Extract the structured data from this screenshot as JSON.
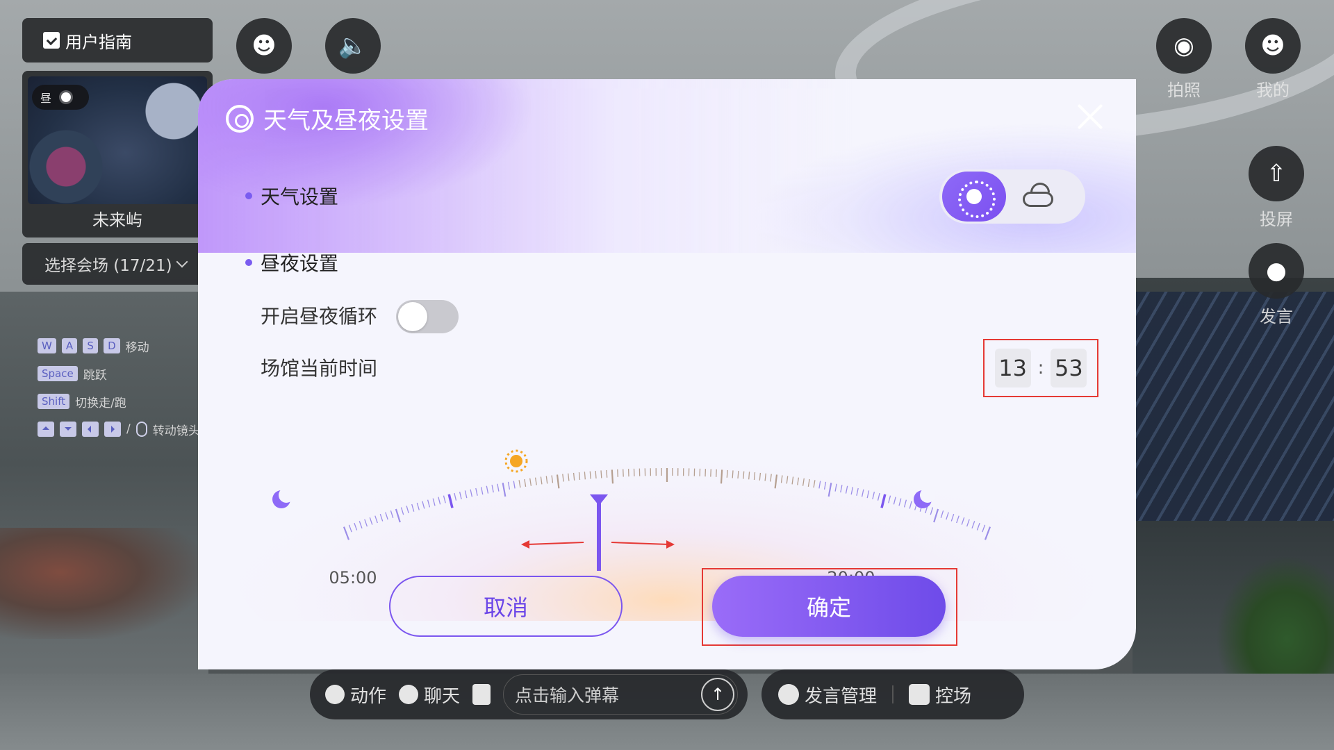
{
  "top_left": {
    "guide_label": "用户指南",
    "minimap": {
      "badge_label": "昼",
      "name": "未来屿"
    },
    "venue_select": "选择会场 (17/21)"
  },
  "key_hints": [
    {
      "keys": [
        "W",
        "A",
        "S",
        "D"
      ],
      "label": "移动"
    },
    {
      "keys": [
        "Space"
      ],
      "label": "跳跃"
    },
    {
      "keys": [
        "Shift"
      ],
      "label": "切换走/跑"
    },
    {
      "keys": [
        "arrows",
        "mouse"
      ],
      "label": "转动镜头"
    }
  ],
  "right_buttons": [
    {
      "label": "拍照",
      "icon": "camera-icon"
    },
    {
      "label": "我的",
      "icon": "user-icon"
    },
    {
      "label": "投屏",
      "icon": "screen-share-icon"
    },
    {
      "label": "发言",
      "icon": "microphone-icon"
    }
  ],
  "dialog": {
    "title": "天气及昼夜设置",
    "weather_section": "天气设置",
    "weather_options": [
      {
        "icon": "sun-icon",
        "selected": true
      },
      {
        "icon": "cloud-icon",
        "selected": false
      }
    ],
    "daynight_section": "昼夜设置",
    "cycle_label": "开启昼夜循环",
    "cycle_enabled": false,
    "time_label": "场馆当前时间",
    "time_hour": "13",
    "time_sep": ":",
    "time_minute": "53",
    "dial_left_label": "05:00",
    "dial_right_label": "20:00",
    "cancel_label": "取消",
    "confirm_label": "确定",
    "accent_color": "#7b4ff0",
    "highlight_color": "#e53935"
  },
  "bottom_bar": {
    "action_label": "动作",
    "chat_label": "聊天",
    "danmaku_placeholder": "点击输入弹幕",
    "speech_manage_label": "发言管理",
    "control_label": "控场"
  }
}
